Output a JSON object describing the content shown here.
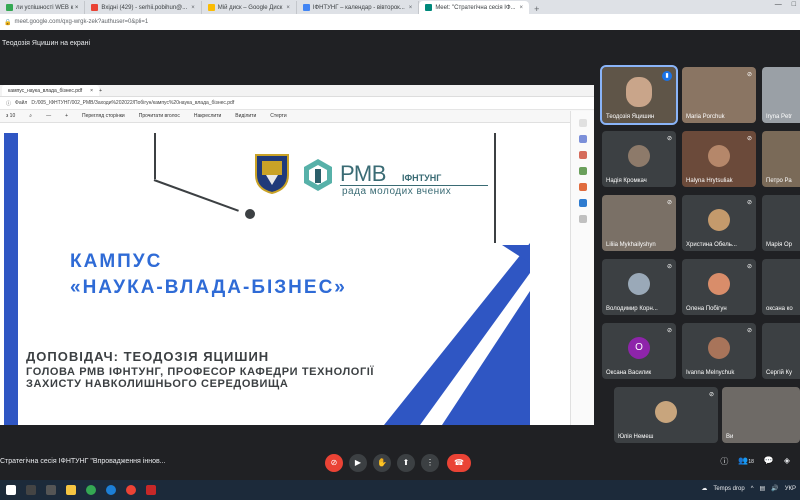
{
  "browser": {
    "tabs": [
      {
        "label": "ли успішності WEB к ×",
        "color": "#34a853"
      },
      {
        "label": "Вхідні (429) - serhii.pobihun@...",
        "color": "#ea4335"
      },
      {
        "label": "Мій диск – Google Диск",
        "color": "#fbbc04"
      },
      {
        "label": "ІФНТУНГ – календар - вівторок...",
        "color": "#4285f4"
      },
      {
        "label": "Meet: \"Стратегічна сесія ІФ...",
        "color": "#00897b",
        "active": true
      }
    ],
    "url": "meet.google.com/qxg-wrgk-zek?authuser=0&pli=1"
  },
  "meet": {
    "presenting_label": "Теодозія Яцишин на екрані",
    "meeting_name": "Стратегічна сесія ІФНТУНГ \"Впровадження іннов...",
    "participant_count": "18"
  },
  "shared": {
    "pdf_tab": "кампус_наука_влада_бізнес.pdf",
    "file_label": "Файл",
    "pdf_path": "D:/005_ІФНТУНГ/002_РМВ/Заходи%202022/Побігун/кампус%20наука_влада_бізнес.pdf",
    "zoom": "з 10",
    "toolbar": [
      "Перегляд сторінки",
      "Прочитати вголос",
      "Накреслити",
      "Виділити",
      "Стерти"
    ],
    "slide": {
      "logo_main": "РМВ",
      "logo_org": "ІФНТУНГ",
      "logo_sub": "рада молодих вчених",
      "title_line1": "КАМПУС",
      "title_line2": "«НАУКА-ВЛАДА-БІЗНЕС»",
      "speaker": "ДОПОВІДАЧ: ТЕОДОЗІЯ ЯЦИШИН",
      "position": "ГОЛОВА РМВ ІФНТУНГ, ПРОФЕСОР КАФЕДРИ ТЕХНОЛОГІЇ ЗАХИСТУ НАВКОЛИШНЬОГО СЕРЕДОВИЩА"
    }
  },
  "participants": [
    {
      "name": "Теодозія Яцишин"
    },
    {
      "name": "Maria Porchuk"
    },
    {
      "name": "Iryna Petr"
    },
    {
      "name": "Надія Кромкач"
    },
    {
      "name": "Halyna Hrytsuliak"
    },
    {
      "name": "Петро Ра"
    },
    {
      "name": "Liliia Mykhailyshyn"
    },
    {
      "name": "Христина Обель..."
    },
    {
      "name": "Марія Ор"
    },
    {
      "name": "Володимир Корн..."
    },
    {
      "name": "Олена Побігун"
    },
    {
      "name": "оксана ко"
    },
    {
      "name": "Оксана Василик",
      "initial": "О"
    },
    {
      "name": "Ivanna Melnychuk"
    },
    {
      "name": "Сергій Ку"
    },
    {
      "name": "Юлія Немеш"
    },
    {
      "name": "Ви"
    }
  ],
  "taskbar": {
    "weather": "Temps drop",
    "lang": "УКР"
  }
}
